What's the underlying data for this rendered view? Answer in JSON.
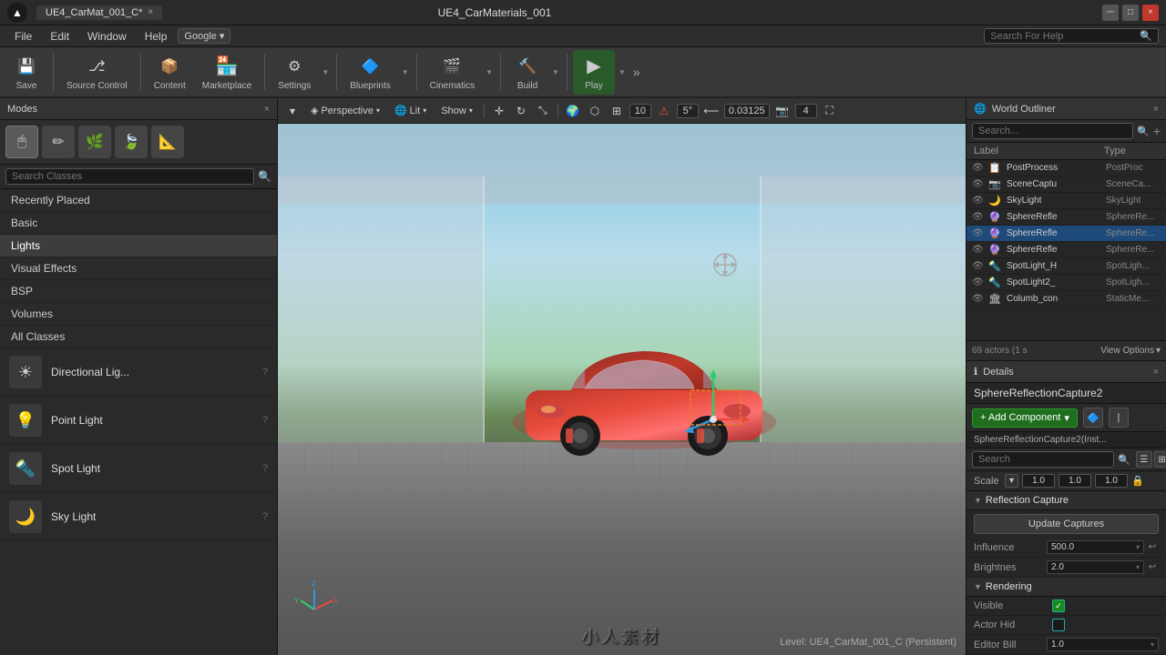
{
  "titlebar": {
    "logo": "▲",
    "tab_label": "UE4_CarMat_001_C*",
    "window_title": "UE4_CarMaterials_001",
    "close_tab": "×",
    "btn_min": "─",
    "btn_max": "□",
    "btn_close": "×"
  },
  "menubar": {
    "items": [
      "File",
      "Edit",
      "Window",
      "Help"
    ],
    "google_label": "Google ▾",
    "search_placeholder": "Search For Help",
    "search_icon": "🔍"
  },
  "toolbar": {
    "buttons": [
      {
        "icon": "💾",
        "label": "Save"
      },
      {
        "icon": "⎇",
        "label": "Source Control"
      },
      {
        "icon": "📦",
        "label": "Content"
      },
      {
        "icon": "🏪",
        "label": "Marketplace"
      },
      {
        "icon": "⚙",
        "label": "Settings"
      },
      {
        "icon": "🔷",
        "label": "Blueprints"
      },
      {
        "icon": "🎬",
        "label": "Cinematics"
      },
      {
        "icon": "🔨",
        "label": "Build"
      },
      {
        "icon": "▶",
        "label": "Play"
      }
    ],
    "more_icon": "»"
  },
  "modes_panel": {
    "title": "Modes",
    "close": "×",
    "icons": [
      "🖱",
      "✏",
      "🌿",
      "🍃",
      "📐"
    ],
    "active_index": 0,
    "search_placeholder": "Search Classes",
    "categories": [
      {
        "label": "Recently Placed",
        "active": false
      },
      {
        "label": "Basic",
        "active": false
      },
      {
        "label": "Lights",
        "active": true
      },
      {
        "label": "Visual Effects",
        "active": false
      },
      {
        "label": "BSP",
        "active": false
      },
      {
        "label": "Volumes",
        "active": false
      },
      {
        "label": "All Classes",
        "active": false
      }
    ],
    "lights": [
      {
        "icon": "☀",
        "label": "Directional Lig...",
        "has_help": true
      },
      {
        "icon": "💡",
        "label": "Point Light",
        "has_help": true
      },
      {
        "icon": "🔦",
        "label": "Spot Light",
        "has_help": true
      },
      {
        "icon": "🌙",
        "label": "Sky Light",
        "has_help": true
      }
    ]
  },
  "viewport": {
    "perspective_label": "Perspective",
    "lit_label": "Lit",
    "show_label": "Show",
    "grid_num": "10",
    "angle_num": "5°",
    "scale_num": "0.03125",
    "cam_num": "4",
    "level_text": "Level:  UE4_CarMat_001_C (Persistent)",
    "watermark": "小人素材"
  },
  "outliner": {
    "title": "World Outliner",
    "close": "×",
    "search_placeholder": "Search...",
    "col_label": "Label",
    "col_type": "Type",
    "items": [
      {
        "label": "PostProcess",
        "type": "PostProc",
        "selected": false
      },
      {
        "label": "SceneCaptu",
        "type": "SceneCa...",
        "selected": false
      },
      {
        "label": "SkyLight",
        "type": "SkyLight",
        "selected": false
      },
      {
        "label": "SphereRefle",
        "type": "SphereRe...",
        "selected": false
      },
      {
        "label": "SphereRefle",
        "type": "SphereRe...",
        "selected": true
      },
      {
        "label": "SphereRefle",
        "type": "SphereRe...",
        "selected": false
      },
      {
        "label": "SpotLight_H",
        "type": "SpotLigh...",
        "selected": false
      },
      {
        "label": "SpotLight2_",
        "type": "SpotLigh...",
        "selected": false
      },
      {
        "label": "Columb_con",
        "type": "StaticMe...",
        "selected": false
      }
    ],
    "footer_count": "69 actors (1 s",
    "view_options_label": "View Options"
  },
  "details": {
    "title": "Details",
    "close": "×",
    "selected_name": "SphereReflectionCapture2",
    "add_component_label": "+ Add Component",
    "component_arrow": "▾",
    "instance_label": "SphereReflectionCapture2(Inst...",
    "search_placeholder": "Search",
    "search_icon": "🔍",
    "scale_label": "Scale",
    "scale_dropdown": "▾",
    "scale_x": "1.0",
    "scale_y": "1.0",
    "scale_z": "1.0",
    "lock_icon": "🔒",
    "sections": [
      {
        "label": "Reflection Capture",
        "props": [
          {
            "label": "Influence",
            "value": "500.0"
          },
          {
            "label": "Brightnes",
            "value": "2.0"
          }
        ],
        "action_btn": "Update Captures"
      },
      {
        "label": "Rendering",
        "props": [
          {
            "label": "Visible",
            "value": "",
            "checkbox": true,
            "checked": true
          },
          {
            "label": "Actor Hid",
            "value": "",
            "checkbox": true,
            "checked": false
          },
          {
            "label": "Editor Bill",
            "value": "1.0"
          }
        ]
      }
    ]
  }
}
